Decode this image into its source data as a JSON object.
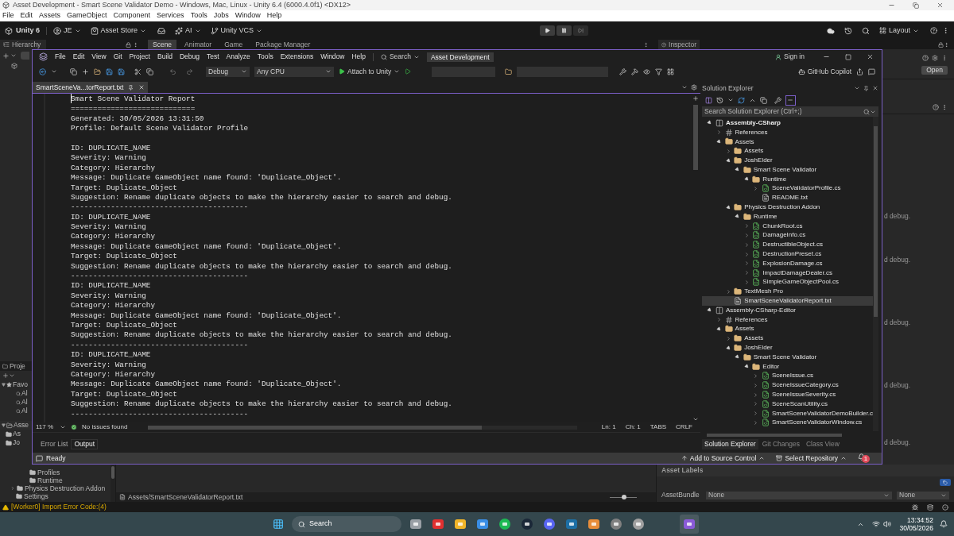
{
  "title_bar": {
    "title": "Asset Development - Smart Scene Validator Demo - Windows, Mac, Linux - Unity 6.4 (6000.4.0f1) <DX12>"
  },
  "menu_bar": [
    "File",
    "Edit",
    "Assets",
    "GameObject",
    "Component",
    "Services",
    "Tools",
    "Jobs",
    "Window",
    "Help"
  ],
  "toolbar": {
    "brand": "Unity 6",
    "account": "JE",
    "items": [
      {
        "label": "Asset Store",
        "kind": "store"
      },
      {
        "label": "AI",
        "kind": "ai"
      },
      {
        "label": "Unity VCS",
        "kind": "vcs"
      }
    ],
    "layout": "Layout"
  },
  "hierarchy_tab": "Hierarchy",
  "scene_tabs": [
    {
      "label": "Scene",
      "selected": true
    },
    {
      "label": "Animator",
      "selected": false
    },
    {
      "label": "Game",
      "selected": false
    },
    {
      "label": "Package Manager",
      "selected": false
    }
  ],
  "inspector_tab": "Inspector",
  "project_fragments": {
    "tab": "Proje",
    "favorites": "Favo",
    "favorite_items": [
      "Al",
      "Al",
      "Al"
    ],
    "assets": "Asse",
    "asset_items": [
      "As",
      "Jo"
    ]
  },
  "inspector": {
    "open_button": "Open",
    "preview_fragments": [
      "d debug.",
      "d debug.",
      "d debug.",
      "d debug.",
      "d debug."
    ]
  },
  "vs": {
    "menu": [
      "File",
      "Edit",
      "View",
      "Git",
      "Project",
      "Build",
      "Debug",
      "Test",
      "Analyze",
      "Tools",
      "Extensions",
      "Window",
      "Help"
    ],
    "search": "Search",
    "solution_badge": "Asset Development",
    "sign_in": "Sign in",
    "toolbar": {
      "configuration": "Debug",
      "platform": "Any CPU",
      "run_target": "Attach to Unity",
      "copilot": "GitHub Copilot"
    },
    "document_tab": {
      "label": "SmartSceneVa...torReport.txt",
      "selected": true
    },
    "document": {
      "header": [
        "Smart Scene Validator Report",
        "============================",
        "Generated: 30/05/2026 13:31:50",
        "Profile: Default Scene Validator Profile"
      ],
      "issues": [
        {
          "lines": [
            "ID: DUPLICATE_NAME",
            "Severity: Warning",
            "Category: Hierarchy",
            "Message: Duplicate GameObject name found: 'Duplicate_Object'.",
            "Target: Duplicate_Object",
            "Suggestion: Rename duplicate objects to make the hierarchy easier to search and debug.",
            "----------------------------------------"
          ]
        },
        {
          "lines": [
            "ID: DUPLICATE_NAME",
            "Severity: Warning",
            "Category: Hierarchy",
            "Message: Duplicate GameObject name found: 'Duplicate_Object'.",
            "Target: Duplicate_Object",
            "Suggestion: Rename duplicate objects to make the hierarchy easier to search and debug.",
            "----------------------------------------"
          ]
        },
        {
          "lines": [
            "ID: DUPLICATE_NAME",
            "Severity: Warning",
            "Category: Hierarchy",
            "Message: Duplicate GameObject name found: 'Duplicate_Object'.",
            "Target: Duplicate_Object",
            "Suggestion: Rename duplicate objects to make the hierarchy easier to search and debug.",
            "----------------------------------------"
          ]
        },
        {
          "lines": [
            "ID: DUPLICATE_NAME",
            "Severity: Warning",
            "Category: Hierarchy",
            "Message: Duplicate GameObject name found: 'Duplicate_Object'.",
            "Target: Duplicate_Object",
            "Suggestion: Rename duplicate objects to make the hierarchy easier to search and debug.",
            "----------------------------------------"
          ]
        }
      ]
    },
    "editor_status": {
      "zoom": "117 %",
      "issues": "No issues found",
      "line": "Ln: 1",
      "column": "Ch: 1",
      "indent": "TABS",
      "line_ending": "CRLF"
    },
    "bottom_tabs": [
      {
        "label": "Error List",
        "selected": false
      },
      {
        "label": "Output",
        "selected": true
      }
    ],
    "status": {
      "text": "Ready",
      "source_control": "Add to Source Control",
      "repository": "Select Repository",
      "notification_count": "1"
    },
    "solution_explorer": {
      "title": "Solution Explorer",
      "search_placeholder": "Search Solution Explorer (Ctrl+;)",
      "tree": [
        {
          "label": "Assembly-CSharp",
          "kind": "project",
          "expanded": true,
          "selected": false,
          "children": [
            {
              "label": "References",
              "kind": "references",
              "expanded": false,
              "selected": false
            },
            {
              "label": "Assets",
              "kind": "folder",
              "expanded": true,
              "selected": false,
              "children": [
                {
                  "label": "Assets",
                  "kind": "folder",
                  "expanded": false,
                  "selected": false
                },
                {
                  "label": "JoshElder",
                  "kind": "folder",
                  "expanded": true,
                  "selected": false,
                  "children": [
                    {
                      "label": "Smart Scene Validator",
                      "kind": "folder",
                      "expanded": true,
                      "selected": false,
                      "children": [
                        {
                          "label": "Runtime",
                          "kind": "folder",
                          "expanded": true,
                          "selected": false,
                          "children": [
                            {
                              "label": "SceneValidatorProfile.cs",
                              "kind": "cs",
                              "expanded": false,
                              "selected": false
                            },
                            {
                              "label": "README.txt",
                              "kind": "txt",
                              "selected": false
                            }
                          ]
                        }
                      ]
                    }
                  ]
                },
                {
                  "label": "Physics Destruction Addon",
                  "kind": "folder",
                  "expanded": true,
                  "selected": false,
                  "children": [
                    {
                      "label": "Runtime",
                      "kind": "folder",
                      "expanded": true,
                      "selected": false,
                      "children": [
                        {
                          "label": "ChunkRoot.cs",
                          "kind": "cs",
                          "expanded": false,
                          "selected": false
                        },
                        {
                          "label": "DamageInfo.cs",
                          "kind": "cs",
                          "expanded": false,
                          "selected": false
                        },
                        {
                          "label": "DestructibleObject.cs",
                          "kind": "cs",
                          "expanded": false,
                          "selected": false
                        },
                        {
                          "label": "DestructionPreset.cs",
                          "kind": "cs",
                          "expanded": false,
                          "selected": false
                        },
                        {
                          "label": "ExplosionDamage.cs",
                          "kind": "cs",
                          "expanded": false,
                          "selected": false
                        },
                        {
                          "label": "ImpactDamageDealer.cs",
                          "kind": "cs",
                          "expanded": false,
                          "selected": false
                        },
                        {
                          "label": "SimpleGameObjectPool.cs",
                          "kind": "cs",
                          "expanded": false,
                          "selected": false
                        }
                      ]
                    }
                  ]
                },
                {
                  "label": "TextMesh Pro",
                  "kind": "folder",
                  "expanded": false,
                  "selected": false
                },
                {
                  "label": "SmartSceneValidatorReport.txt",
                  "kind": "txt",
                  "selected": true
                }
              ]
            }
          ]
        },
        {
          "label": "Assembly-CSharp-Editor",
          "kind": "project",
          "expanded": true,
          "selected": false,
          "children": [
            {
              "label": "References",
              "kind": "references",
              "expanded": false,
              "selected": false
            },
            {
              "label": "Assets",
              "kind": "folder",
              "expanded": true,
              "selected": false,
              "children": [
                {
                  "label": "Assets",
                  "kind": "folder",
                  "expanded": false,
                  "selected": false
                },
                {
                  "label": "JoshElder",
                  "kind": "folder",
                  "expanded": true,
                  "selected": false,
                  "children": [
                    {
                      "label": "Smart Scene Validator",
                      "kind": "folder",
                      "expanded": true,
                      "selected": false,
                      "children": [
                        {
                          "label": "Editor",
                          "kind": "folder",
                          "expanded": true,
                          "selected": false,
                          "children": [
                            {
                              "label": "SceneIssue.cs",
                              "kind": "cs",
                              "expanded": false,
                              "selected": false
                            },
                            {
                              "label": "SceneIssueCategory.cs",
                              "kind": "cs",
                              "expanded": false,
                              "selected": false
                            },
                            {
                              "label": "SceneIssueSeverity.cs",
                              "kind": "cs",
                              "expanded": false,
                              "selected": false
                            },
                            {
                              "label": "SceneScanUtility.cs",
                              "kind": "cs",
                              "expanded": false,
                              "selected": false
                            },
                            {
                              "label": "SmartSceneValidatorDemoBuilder.c",
                              "kind": "cs",
                              "expanded": false,
                              "selected": false
                            },
                            {
                              "label": "SmartSceneValidatorWindow.cs",
                              "kind": "cs",
                              "expanded": false,
                              "selected": false
                            }
                          ]
                        }
                      ]
                    }
                  ]
                }
              ]
            }
          ]
        }
      ],
      "tabs": [
        {
          "label": "Solution Explorer",
          "selected": true
        },
        {
          "label": "Git Changes",
          "selected": false
        },
        {
          "label": "Class View",
          "selected": false
        }
      ]
    }
  },
  "project_tree": [
    {
      "label": "Profiles",
      "kind": "nested"
    },
    {
      "label": "Runtime",
      "kind": "nested"
    },
    {
      "label": "Physics Destruction Addon",
      "kind": "group",
      "expanded": false
    },
    {
      "label": "Settings",
      "kind": "folder"
    }
  ],
  "path_bar": "Assets/SmartSceneValidatorReport.txt",
  "size_slider": {
    "level": 0.55
  },
  "asset_labels": "Asset Labels",
  "asset_bundle": {
    "label": "AssetBundle",
    "value": "None",
    "variant": "None"
  },
  "unity_status": {
    "message": "[Worker0] Import Error Code:(4)"
  },
  "taskbar": {
    "search": "Search",
    "time": "13:34:52",
    "date": "30/05/2026"
  }
}
